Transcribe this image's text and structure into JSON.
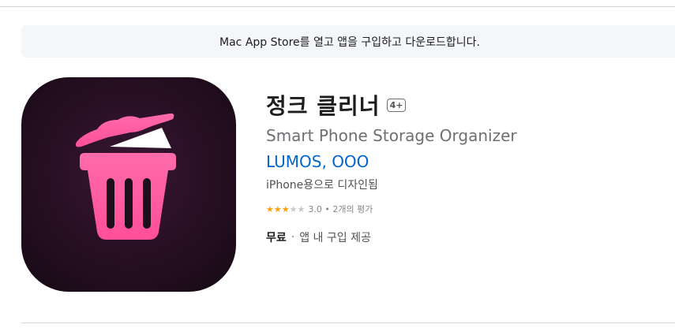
{
  "banner": {
    "text": "Mac App Store를 열고 앱을 구입하고 다운로드합니다."
  },
  "app": {
    "icon": "trash-can-icon",
    "title": "정크 클리너",
    "age_rating": "4+",
    "subtitle": "Smart Phone Storage Organizer",
    "developer": "LUMOS, OOO",
    "designed_for": "iPhone용으로 디자인됨",
    "rating": {
      "stars": 3.0,
      "max_stars": 5,
      "text": "3.0 • 2개의 평가"
    },
    "price": "무료",
    "separator": "·",
    "in_app": "앱 내 구입 제공"
  },
  "colors": {
    "icon_background": "#1e0e1c",
    "icon_pink": "#ff5aa0",
    "link_blue": "#0066cc",
    "star_orange": "#ff9f0a",
    "banner_bg": "#f4f6f9"
  }
}
